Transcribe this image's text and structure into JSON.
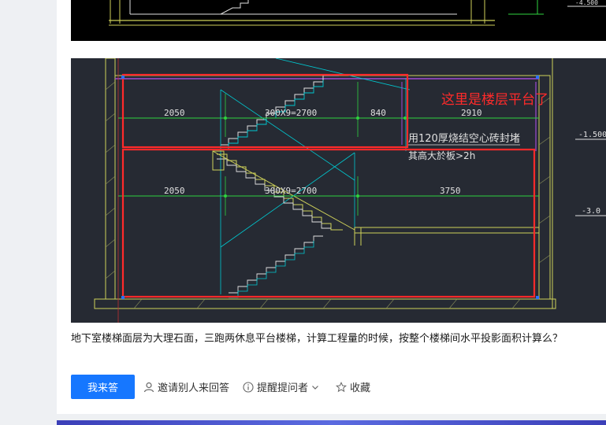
{
  "question": {
    "text": "地下室楼梯面层为大理石面，三跑两休息平台楼梯，计算工程量的时候，按整个楼梯间水平投影面积计算么？"
  },
  "drawing": {
    "dims_upper": [
      "2050",
      "300X9=2700",
      "840",
      "2910"
    ],
    "dims_lower": [
      "2050",
      "300X9=2700",
      "3750"
    ],
    "annotation_red": "这里是楼层平台了",
    "note_line1": "用120厚烧结空心砖封堵",
    "note_line2": "其高大於板>2h",
    "elev_1": "-1.500",
    "elev_2": "-3.0",
    "elev_top": "-4.500"
  },
  "actions": {
    "answer_label": "我来答",
    "invite_label": "邀请别人来回答",
    "remind_label": "提醒提问者",
    "favorite_label": "收藏"
  },
  "colors": {
    "primary": "#1677ff",
    "cad_bg": "#262a33",
    "annotation_red": "#ff2a2a"
  }
}
